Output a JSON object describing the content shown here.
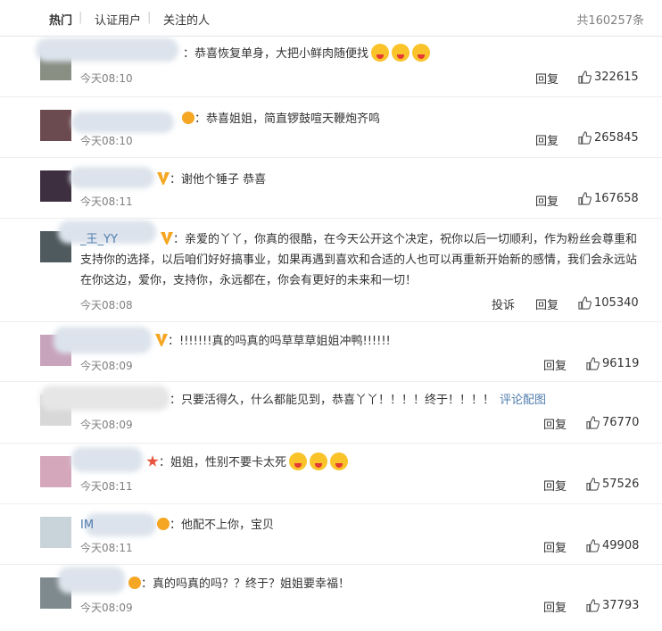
{
  "tabs": [
    {
      "label": "热门",
      "active": true
    },
    {
      "label": "认证用户"
    },
    {
      "label": "关注的人"
    }
  ],
  "total": "共160257条",
  "reply_label": "回复",
  "report_label": "投诉",
  "comments": [
    {
      "name": "锦鲤能量",
      "text": "：恭喜恢复单身，大把小鲜肉随便找",
      "emoji_count": 3,
      "time": "今天08:10",
      "likes": "322615"
    },
    {
      "name": "xx",
      "text": "：恭喜姐姐，简直锣鼓喧天鞭炮齐鸣",
      "time": "今天08:10",
      "likes": "265845"
    },
    {
      "name": "xx",
      "text": "：谢他个锤子 恭喜",
      "time": "今天08:11",
      "likes": "167658"
    },
    {
      "name": "_王_YY",
      "text": "：亲爱的丫丫，你真的很酷，在今天公开这个决定，祝你以后一切顺利，作为粉丝会尊重和支持你的选择，以后咱们好好搞事业，如果再遇到喜欢和合适的人也可以再重新开始新的感情，我们会永远站在你这边，爱你，支持你，永远都在，你会有更好的未来和一切！",
      "time": "今天08:08",
      "likes": "105340",
      "has_report": true
    },
    {
      "name": "xx",
      "text": "：!!!!!!!真的吗真的吗草草草姐姐冲鸭!!!!!!",
      "time": "今天08:09",
      "likes": "96119"
    },
    {
      "name": "xx",
      "text": "：只要活得久，什么都能见到，恭喜丫丫！！！！终于！！！！",
      "link": "评论配图",
      "time": "今天08:09",
      "likes": "76770"
    },
    {
      "name": "xx",
      "text": "：姐姐，性别不要卡太死",
      "emoji_count": 3,
      "time": "今天08:11",
      "likes": "57526"
    },
    {
      "name": "IM",
      "text": "：他配不上你，宝贝",
      "time": "今天08:11",
      "likes": "49908"
    },
    {
      "name": "xx",
      "text": "：真的吗真的吗？？终于？姐姐要幸福！",
      "time": "今天08:09",
      "likes": "37793"
    }
  ]
}
